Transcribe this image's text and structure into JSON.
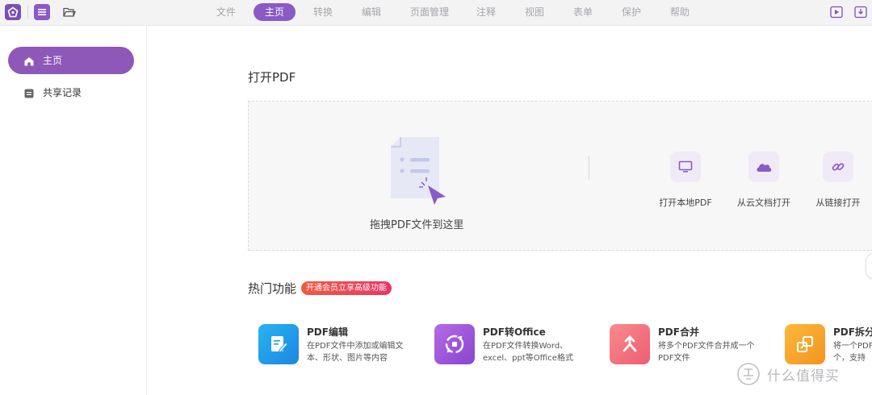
{
  "topbar": {
    "tabs": [
      {
        "label": "文件",
        "active": false
      },
      {
        "label": "主页",
        "active": true
      },
      {
        "label": "转换",
        "active": false
      },
      {
        "label": "编辑",
        "active": false
      },
      {
        "label": "页面管理",
        "active": false
      },
      {
        "label": "注释",
        "active": false
      },
      {
        "label": "视图",
        "active": false
      },
      {
        "label": "表单",
        "active": false
      },
      {
        "label": "保护",
        "active": false
      },
      {
        "label": "帮助",
        "active": false
      }
    ],
    "icons": [
      "app-logo-icon",
      "menu-icon",
      "folder-open-icon",
      "play-icon",
      "download-icon"
    ]
  },
  "sidebar": {
    "items": [
      {
        "label": "主页",
        "icon": "home-icon",
        "active": true
      },
      {
        "label": "共享记录",
        "icon": "document-icon",
        "active": false
      }
    ]
  },
  "open_pdf": {
    "title": "打开PDF",
    "drop_text": "拖拽PDF文件到这里",
    "options": [
      {
        "label": "打开本地PDF",
        "icon": "monitor-icon"
      },
      {
        "label": "从云文档打开",
        "icon": "cloud-icon"
      },
      {
        "label": "从链接打开",
        "icon": "link-icon"
      }
    ]
  },
  "hot_features": {
    "title": "热门功能",
    "badge": "开通会员立享高级功能",
    "items": [
      {
        "title": "PDF编辑",
        "desc_line1": "在PDF文件中添加或编辑文",
        "desc_line2": "本、形状、图片等内容",
        "icon": "edit-icon"
      },
      {
        "title": "PDF转Office",
        "desc_line1": "在PDF文件转换Word、",
        "desc_line2": "excel、ppt等Office格式",
        "icon": "convert-icon"
      },
      {
        "title": "PDF合并",
        "desc_line1": "将多个PDF文件合并成一个",
        "desc_line2": "PDF文件",
        "icon": "merge-icon"
      },
      {
        "title": "PDF拆分",
        "desc_line1": "将一个PDF",
        "desc_line2": "个，支持",
        "icon": "split-icon"
      }
    ]
  },
  "watermark": {
    "text": "什么值得买"
  },
  "colors": {
    "accent": "#8a5ac6",
    "badge": "#e8346a",
    "edit_icon": "#2a9ee8",
    "convert_icon": "#a25ad8",
    "merge_icon": "#f0707e",
    "split_icon": "#f7a32a"
  }
}
